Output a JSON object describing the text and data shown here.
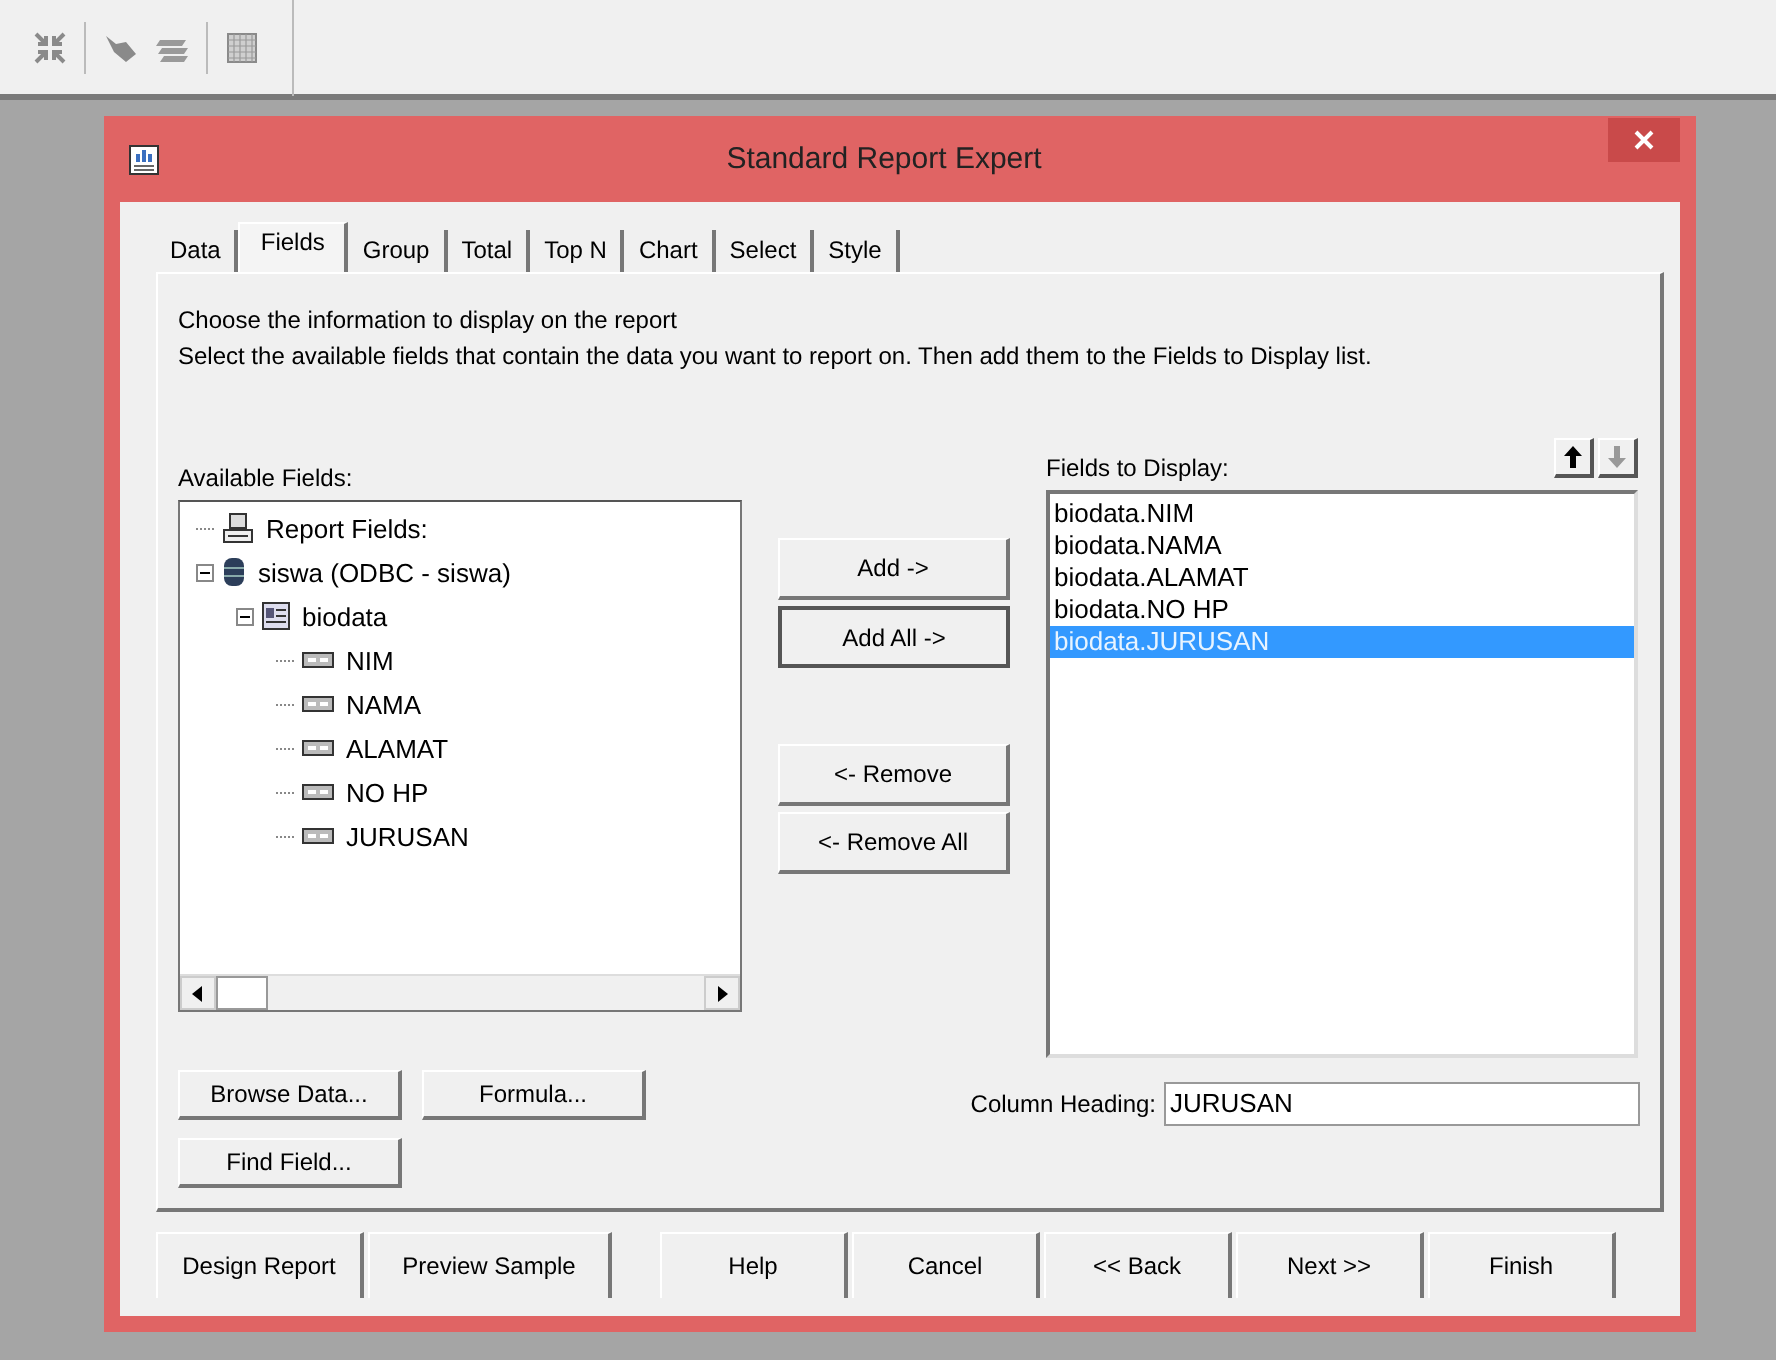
{
  "window": {
    "title": "Standard Report Expert"
  },
  "tabs": [
    {
      "label": "Data",
      "selected": false
    },
    {
      "label": "Fields",
      "selected": true
    },
    {
      "label": "Group",
      "selected": false
    },
    {
      "label": "Total",
      "selected": false
    },
    {
      "label": "Top N",
      "selected": false
    },
    {
      "label": "Chart",
      "selected": false
    },
    {
      "label": "Select",
      "selected": false
    },
    {
      "label": "Style",
      "selected": false
    }
  ],
  "instructions": [
    "Choose the information to display on the report",
    "Select the available fields that contain the data you want to report on.  Then add them to the Fields to Display list."
  ],
  "available_fields": {
    "label": "Available Fields:",
    "tree": [
      {
        "label": "Report Fields:",
        "kind": "group"
      },
      {
        "label": "siswa (ODBC - siswa)",
        "kind": "database",
        "expanded": true,
        "children": [
          {
            "label": "biodata",
            "kind": "table",
            "expanded": true,
            "children": [
              {
                "label": "NIM",
                "kind": "field"
              },
              {
                "label": "NAMA",
                "kind": "field"
              },
              {
                "label": "ALAMAT",
                "kind": "field"
              },
              {
                "label": "NO HP",
                "kind": "field"
              },
              {
                "label": "JURUSAN",
                "kind": "field"
              }
            ]
          }
        ]
      }
    ]
  },
  "move_buttons": [
    "Add ->",
    "Add All ->",
    "<- Remove",
    "<- Remove All"
  ],
  "fields_to_display": {
    "label": "Fields to Display:",
    "items": [
      {
        "label": "biodata.NIM",
        "selected": false
      },
      {
        "label": "biodata.NAMA",
        "selected": false
      },
      {
        "label": "biodata.ALAMAT",
        "selected": false
      },
      {
        "label": "biodata.NO HP",
        "selected": false
      },
      {
        "label": "biodata.JURUSAN",
        "selected": true
      }
    ]
  },
  "field_buttons": [
    "Browse Data...",
    "Formula...",
    "Find Field..."
  ],
  "column_heading": {
    "label": "Column Heading:",
    "value": "JURUSAN"
  },
  "footer_buttons": [
    "Design Report",
    "Preview Sample",
    "Help",
    "Cancel",
    "<< Back",
    "Next >>",
    "Finish"
  ]
}
